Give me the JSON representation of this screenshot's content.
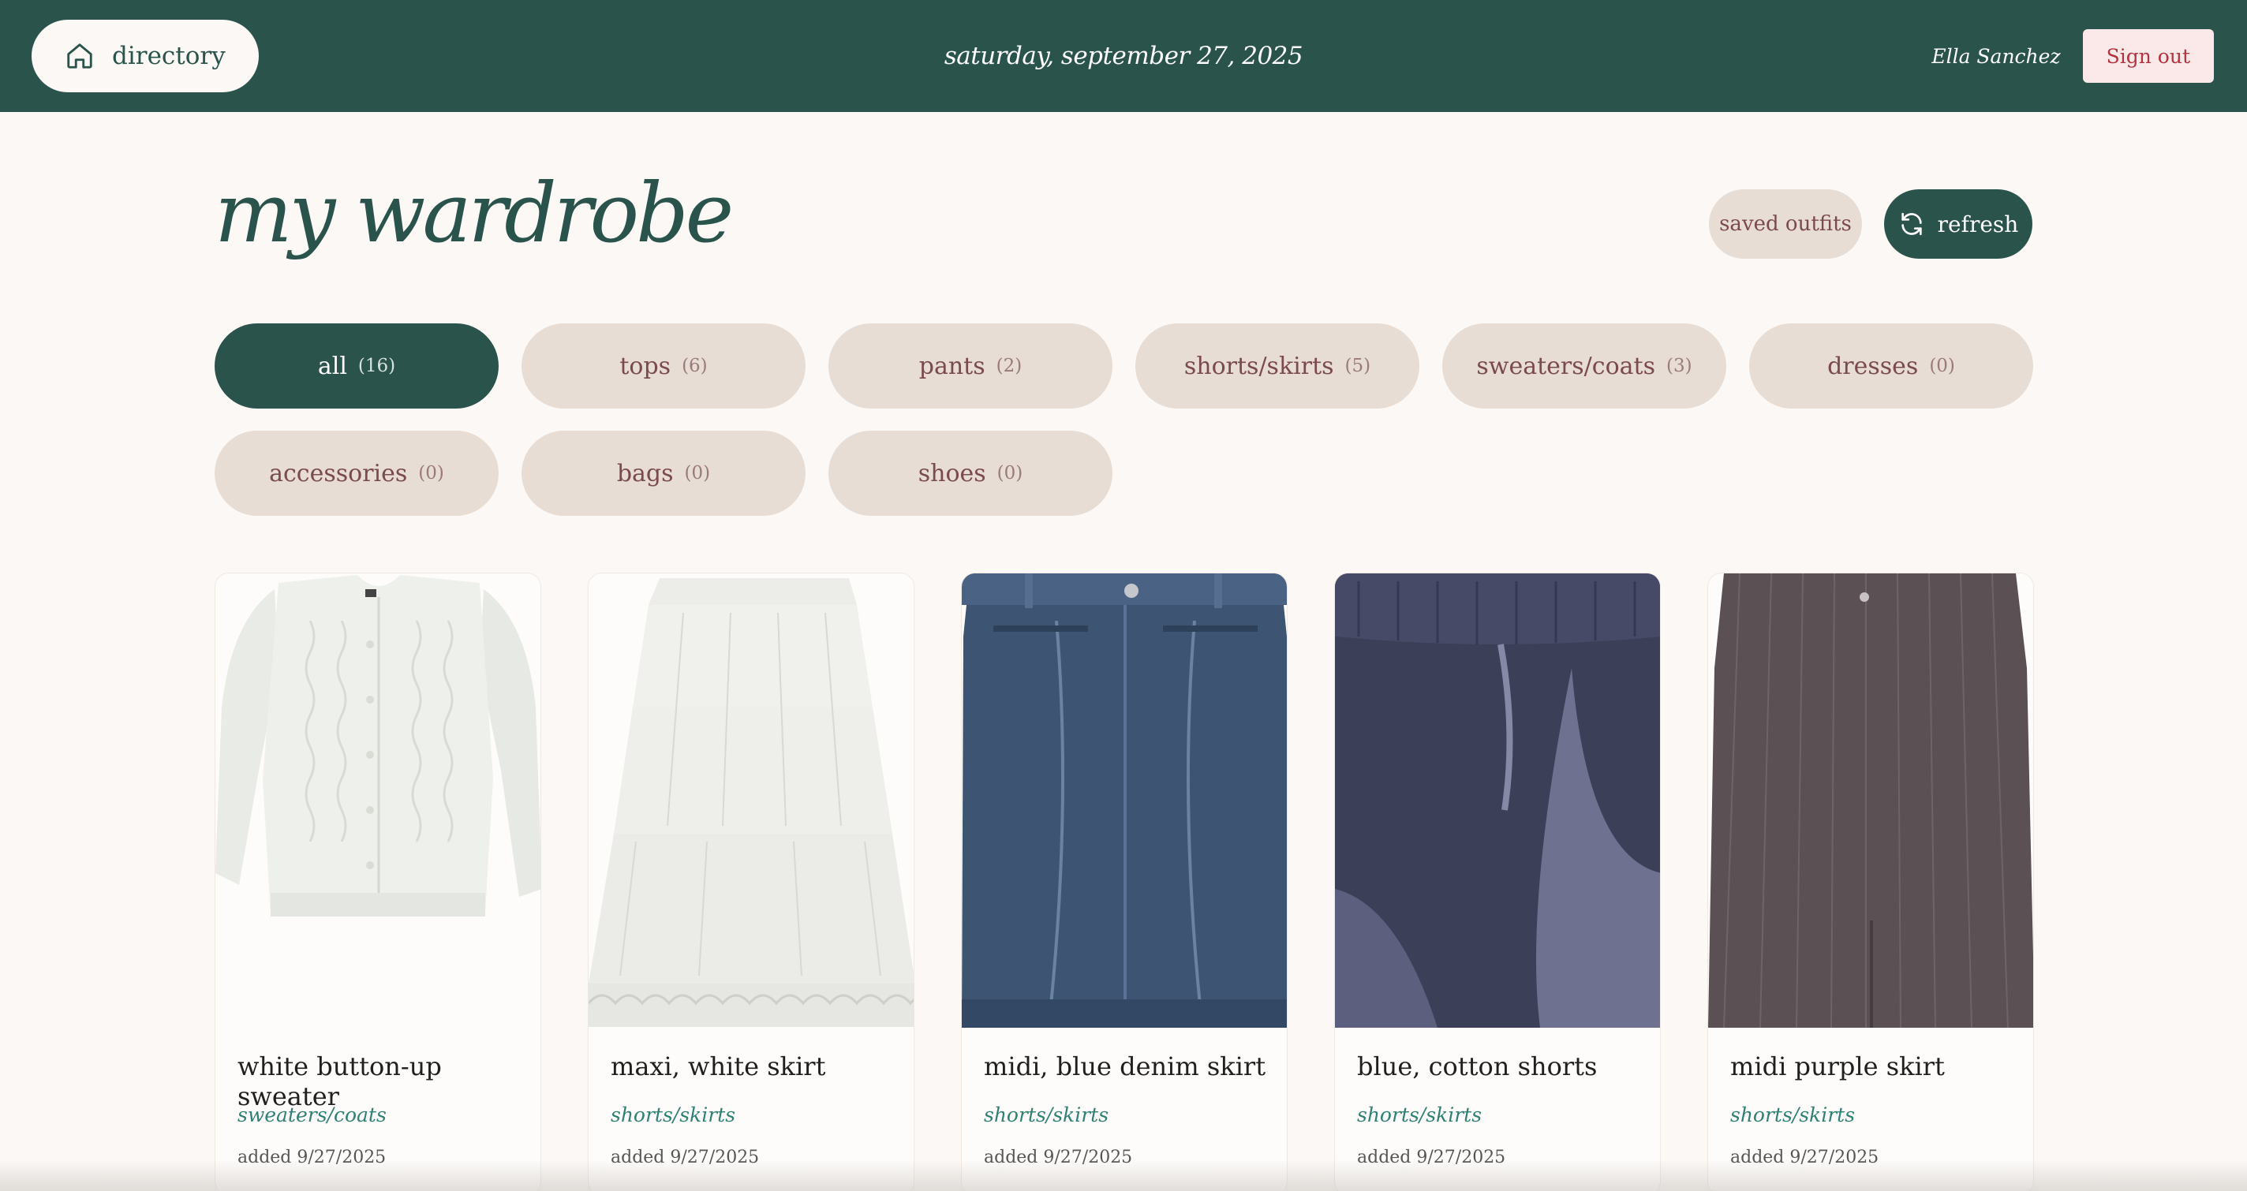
{
  "topbar": {
    "directory_label": "directory",
    "date": "saturday, september 27, 2025",
    "username": "Ella Sanchez",
    "signout_label": "Sign out"
  },
  "header": {
    "title": "my wardrobe",
    "saved_outfits_label": "saved outfits",
    "refresh_label": "refresh"
  },
  "categories": [
    {
      "label": "all",
      "count": "(16)",
      "active": true
    },
    {
      "label": "tops",
      "count": "(6)"
    },
    {
      "label": "pants",
      "count": "(2)"
    },
    {
      "label": "shorts/skirts",
      "count": "(5)"
    },
    {
      "label": "sweaters/coats",
      "count": "(3)"
    },
    {
      "label": "dresses",
      "count": "(0)"
    },
    {
      "label": "accessories",
      "count": "(0)"
    },
    {
      "label": "bags",
      "count": "(0)"
    },
    {
      "label": "shoes",
      "count": "(0)"
    }
  ],
  "items": [
    {
      "name": "white button-up sweater",
      "category": "sweaters/coats",
      "added": "added 9/27/2025"
    },
    {
      "name": "maxi, white skirt",
      "category": "shorts/skirts",
      "added": "added 9/27/2025"
    },
    {
      "name": "midi, blue denim skirt",
      "category": "shorts/skirts",
      "added": "added 9/27/2025"
    },
    {
      "name": "blue, cotton shorts",
      "category": "shorts/skirts",
      "added": "added 9/27/2025"
    },
    {
      "name": "midi purple skirt",
      "category": "shorts/skirts",
      "added": "added 9/27/2025"
    }
  ],
  "colors": {
    "brand": "#2a534c",
    "background": "#fbf8f5",
    "pill": "#e7ddd4",
    "category_text": "#2f8074",
    "signout_bg": "#fbe8e8"
  }
}
